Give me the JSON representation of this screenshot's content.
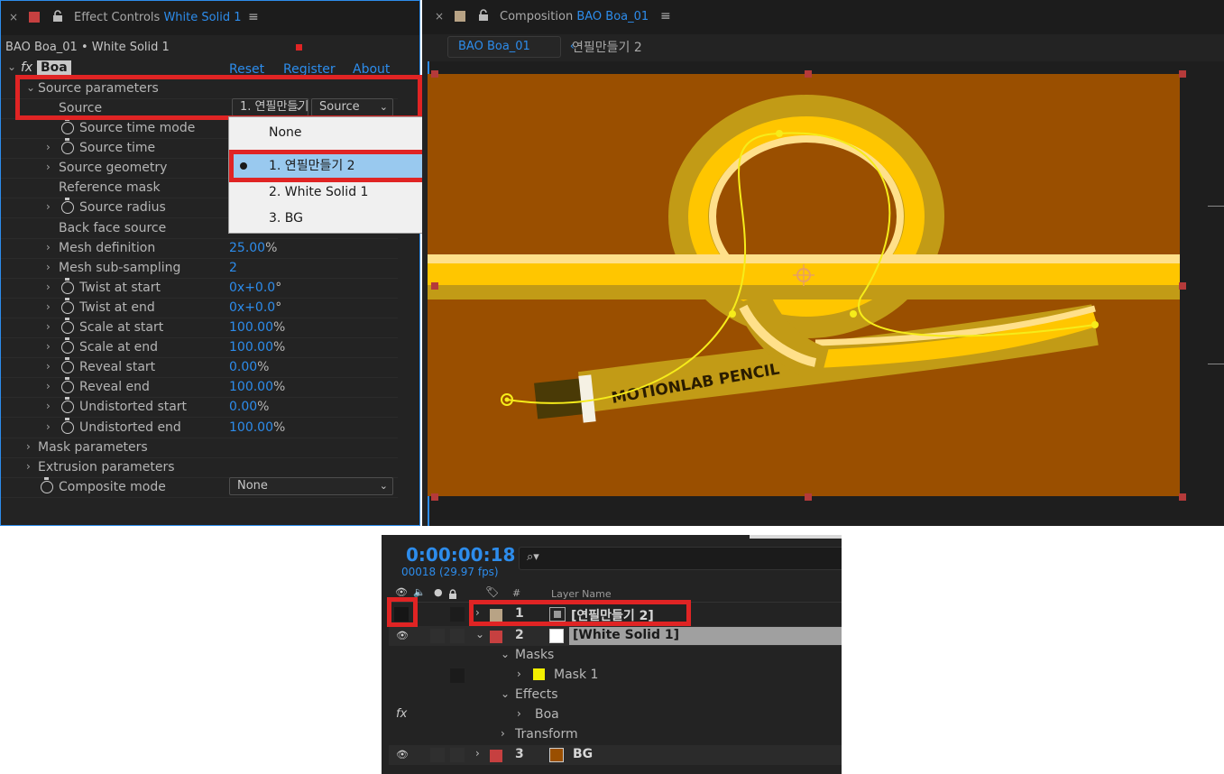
{
  "effect_controls": {
    "tab_label": "Effect Controls",
    "tab_layer": "White Solid 1",
    "subtitle": "BAO Boa_01 • White Solid 1",
    "fx_label": "fx",
    "effect_name": "Boa",
    "links": {
      "reset": "Reset",
      "register": "Register",
      "about": "About"
    },
    "group_source": "Source parameters",
    "source_label": "Source",
    "source_dropdown_value": "1. 연필만들기 2",
    "source_dropdown2_value": "Source",
    "params": [
      {
        "label": "Source time mode",
        "value": "",
        "unit": ""
      },
      {
        "label": "Source time",
        "value": "",
        "unit": ""
      },
      {
        "label": "Source geometry",
        "value": "",
        "unit": ""
      },
      {
        "label": "Reference mask",
        "value": "",
        "unit": ""
      },
      {
        "label": "Source radius",
        "value": "",
        "unit": ""
      },
      {
        "label": "Back face source",
        "value": "",
        "unit": ""
      },
      {
        "label": "Mesh definition",
        "value": "25.00",
        "unit": "%"
      },
      {
        "label": "Mesh sub-sampling",
        "value": "2",
        "unit": ""
      },
      {
        "label": "Twist at start",
        "value": "0x+0.0",
        "unit": "°"
      },
      {
        "label": "Twist at end",
        "value": "0x+0.0",
        "unit": "°"
      },
      {
        "label": "Scale at start",
        "value": "100.00",
        "unit": "%"
      },
      {
        "label": "Scale at end",
        "value": "100.00",
        "unit": "%"
      },
      {
        "label": "Reveal start",
        "value": "0.00",
        "unit": "%"
      },
      {
        "label": "Reveal end",
        "value": "100.00",
        "unit": "%"
      },
      {
        "label": "Undistorted start",
        "value": "0.00",
        "unit": "%"
      },
      {
        "label": "Undistorted end",
        "value": "100.00",
        "unit": "%"
      }
    ],
    "group_mask": "Mask parameters",
    "group_extrusion": "Extrusion parameters",
    "composite_label": "Composite mode",
    "composite_value": "None",
    "menu_items": [
      "None",
      "1. 연필만들기 2",
      "2. White Solid 1",
      "3. BG"
    ],
    "menu_selected": 1
  },
  "composition": {
    "tab_label": "Composition",
    "tab_comp": "BAO Boa_01",
    "breadcrumb_active": "BAO Boa_01",
    "breadcrumb_next": "연필만들기 2",
    "pencil_text": "MOTIONLAB PENCIL",
    "bg_color": "#9a4f00",
    "pencil_color": "#ffc600"
  },
  "timeline": {
    "timecode": "0:00:00:18",
    "fps": "00018 (29.97 fps)",
    "search_placeholder": "",
    "col_num": "#",
    "col_name": "Layer Name",
    "layers": [
      {
        "num": "1",
        "name": "[연필만들기 2]",
        "color": "#b8a385"
      },
      {
        "num": "2",
        "name": "[White Solid 1]",
        "color": "#c64040"
      },
      {
        "num": "3",
        "name": "BG",
        "color": "#c64040"
      }
    ],
    "sub_masks": "Masks",
    "mask_1": "Mask 1",
    "sub_effects": "Effects",
    "effect_boa": "Boa",
    "sub_transform": "Transform",
    "fx_label": "fx"
  }
}
